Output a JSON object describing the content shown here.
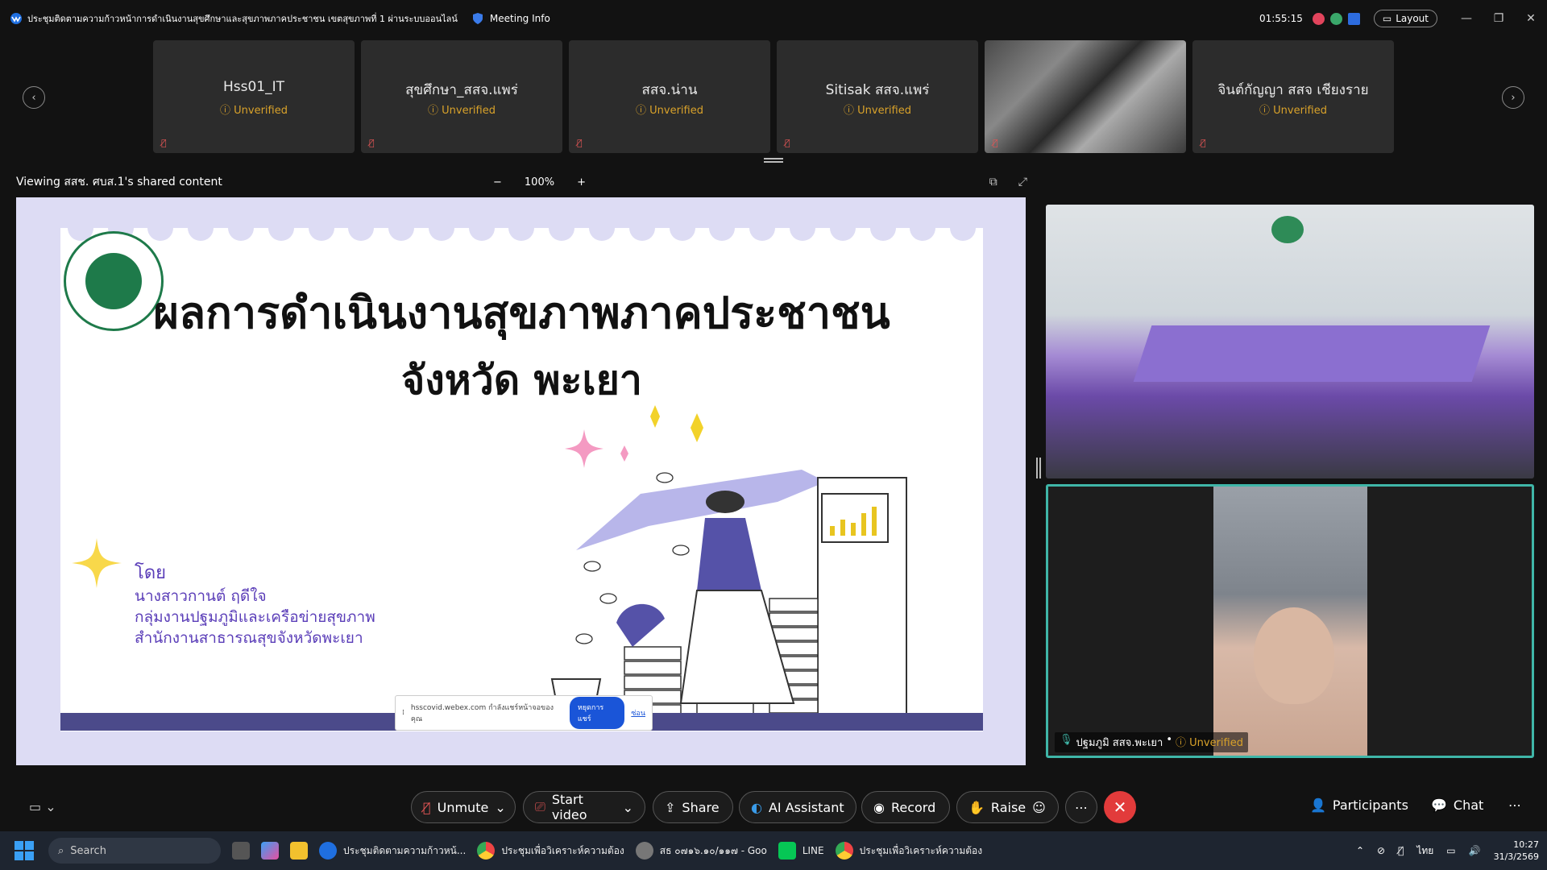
{
  "titlebar": {
    "title": "ประชุมติดตามความก้าวหน้าการดำเนินงานสุขศึกษาและสุขภาพภาคประชาชน เขตสุขภาพที่ 1 ผ่านระบบออนไลน์",
    "meeting_info": "Meeting Info",
    "timer": "01:55:15",
    "layout_label": "Layout"
  },
  "participants_strip": [
    {
      "name": "Hss01_IT",
      "status": "Unverified"
    },
    {
      "name": "สุขศึกษา_สสจ.แพร่",
      "status": "Unverified"
    },
    {
      "name": "สสจ.น่าน",
      "status": "Unverified"
    },
    {
      "name": "Sitisak สสจ.แพร่",
      "status": "Unverified"
    },
    {
      "name": "",
      "status": ""
    },
    {
      "name": "จินต์กัญญา สสจ เชียงราย",
      "status": "Unverified"
    }
  ],
  "viewbar": {
    "label": "Viewing สสช. ศบส.1's shared content",
    "zoom": "100%"
  },
  "slide": {
    "title_line1": "ผลการดำเนินงานสุขภาพภาคประชาชน",
    "title_line2": "จังหวัด พะเยา",
    "by": "โดย",
    "presenter": "นางสาวกานต์ ฤดีใจ",
    "unit": "กลุ่มงานปฐมภูมิและเครือข่ายสุขภาพ",
    "office": "สำนักงานสาธารณสุขจังหวัดพะเยา"
  },
  "share_notification": {
    "text": "hsscovid.webex.com กำลังแชร์หน้าจอของคุณ",
    "stop_button": "หยุดการแชร์",
    "hide_link": "ซ่อน"
  },
  "video_panes": {
    "active_speaker_name": "ปฐมภูมิ สสจ.พะเยา",
    "active_speaker_status": "Unverified"
  },
  "controls": {
    "unmute": "Unmute",
    "start_video": "Start video",
    "share": "Share",
    "ai_assistant": "AI Assistant",
    "record": "Record",
    "raise": "Raise",
    "participants": "Participants",
    "chat": "Chat"
  },
  "taskbar": {
    "search": "Search",
    "apps": [
      "ประชุมติดตามความก้าวหน้...",
      "ประชุมเพื่อวิเคราะห์ความต้อง",
      "สธ ๐๗๑๖.๑๐/๑๑๗ - Goo",
      "LINE",
      "ประชุมเพื่อวิเคราะห์ความต้อง"
    ],
    "lang": "ไทย",
    "time": "10:27",
    "date": "31/3/2569"
  },
  "colors": {
    "unverified": "#d9a22a",
    "leave_red": "#e23b3b",
    "slide_purple": "#5a3db8",
    "active_border": "#3fb6a8"
  }
}
